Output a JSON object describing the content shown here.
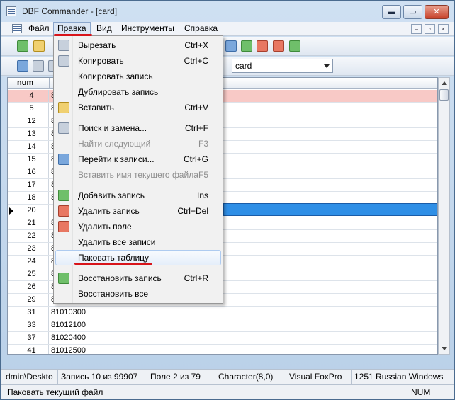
{
  "window": {
    "title": "DBF Commander - [card]",
    "min_label": "▬",
    "max_label": "▭",
    "close_label": "✕"
  },
  "menubar": {
    "items": [
      "Файл",
      "Правка",
      "Вид",
      "Инструменты",
      "Справка"
    ],
    "mdi": [
      "–",
      "▫",
      "×"
    ]
  },
  "toolbar2": {
    "combo_value": "card"
  },
  "grid": {
    "header": "num",
    "rows": [
      {
        "num": "4",
        "card": "8"
      },
      {
        "num": "5",
        "card": "8"
      },
      {
        "num": "12",
        "card": "8"
      },
      {
        "num": "13",
        "card": "8"
      },
      {
        "num": "14",
        "card": "8"
      },
      {
        "num": "15",
        "card": "8"
      },
      {
        "num": "16",
        "card": "8"
      },
      {
        "num": "17",
        "card": "8"
      },
      {
        "num": "18",
        "card": "8"
      },
      {
        "num": "20",
        "card": ""
      },
      {
        "num": "21",
        "card": "8"
      },
      {
        "num": "22",
        "card": "8"
      },
      {
        "num": "23",
        "card": "8"
      },
      {
        "num": "24",
        "card": "8"
      },
      {
        "num": "25",
        "card": "8"
      },
      {
        "num": "26",
        "card": "8"
      },
      {
        "num": "29",
        "card": "8"
      },
      {
        "num": "31",
        "card": "81010300"
      },
      {
        "num": "33",
        "card": "81012100"
      },
      {
        "num": "37",
        "card": "81020400"
      },
      {
        "num": "41",
        "card": "81012500"
      }
    ]
  },
  "dropdown": {
    "items": [
      {
        "label": "Вырезать",
        "shortcut": "Ctrl+X",
        "icon": "scissors-icon",
        "disabled": false
      },
      {
        "label": "Копировать",
        "shortcut": "Ctrl+C",
        "icon": "copy-icon",
        "disabled": false
      },
      {
        "label": "Копировать запись",
        "shortcut": "",
        "icon": "",
        "disabled": false
      },
      {
        "label": "Дублировать запись",
        "shortcut": "",
        "icon": "",
        "disabled": false
      },
      {
        "label": "Вставить",
        "shortcut": "Ctrl+V",
        "icon": "paste-icon",
        "disabled": false
      },
      {
        "label": "Поиск и замена...",
        "shortcut": "Ctrl+F",
        "icon": "binoculars-icon",
        "disabled": false
      },
      {
        "label": "Найти следующий",
        "shortcut": "F3",
        "icon": "",
        "disabled": true
      },
      {
        "label": "Перейти к записи...",
        "shortcut": "Ctrl+G",
        "icon": "goto-record-icon",
        "disabled": false
      },
      {
        "label": "Вставить имя текущего файла",
        "shortcut": "F5",
        "icon": "",
        "disabled": true
      },
      {
        "label": "Добавить запись",
        "shortcut": "Ins",
        "icon": "add-record-icon",
        "disabled": false
      },
      {
        "label": "Удалить запись",
        "shortcut": "Ctrl+Del",
        "icon": "delete-record-icon",
        "disabled": false
      },
      {
        "label": "Удалить поле",
        "shortcut": "",
        "icon": "delete-field-icon",
        "disabled": false
      },
      {
        "label": "Удалить все записи",
        "shortcut": "",
        "icon": "",
        "disabled": false
      },
      {
        "label": "Паковать таблицу",
        "shortcut": "",
        "icon": "",
        "disabled": false
      },
      {
        "label": "Восстановить запись",
        "shortcut": "Ctrl+R",
        "icon": "restore-record-icon",
        "disabled": false
      },
      {
        "label": "Восстановить все",
        "shortcut": "",
        "icon": "",
        "disabled": false
      }
    ]
  },
  "statusbar": {
    "path": "dmin\\Deskto",
    "record": "Запись 10 из 99907",
    "field": "Поле 2 из 79",
    "type": "Character(8,0)",
    "format": "Visual FoxPro",
    "codepage": "1251 Russian Windows",
    "hint": "Паковать текущий файл",
    "num": "NUM"
  },
  "colors": {
    "highlight_row": "#f8c9c6",
    "selected_cell": "#2f8fe6",
    "annotation": "#d8141a"
  }
}
